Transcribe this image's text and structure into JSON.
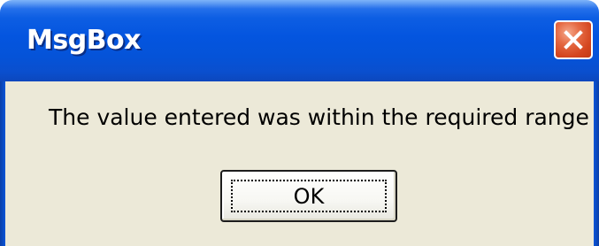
{
  "window": {
    "title": "MsgBox",
    "close_icon": "close-x-icon"
  },
  "dialog": {
    "message": "The value entered was within the required range",
    "ok_label": "OK"
  },
  "colors": {
    "titlebar": "#0455df",
    "client_background": "#ece9d8",
    "close_button": "#d4461f"
  }
}
